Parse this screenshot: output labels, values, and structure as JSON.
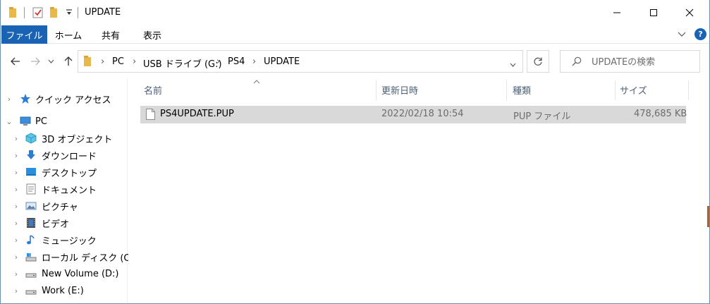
{
  "window": {
    "title": "UPDATE",
    "buttons": {
      "minimize": "—",
      "maximize": "☐",
      "close": "✕"
    }
  },
  "ribbon": {
    "tabs": [
      {
        "label": "ファイル",
        "active": true
      },
      {
        "label": "ホーム"
      },
      {
        "label": "共有"
      },
      {
        "label": "表示"
      }
    ],
    "help": "?"
  },
  "address": {
    "breadcrumbs": [
      "PC",
      "USB ドライブ (G:)",
      "PS4",
      "UPDATE"
    ]
  },
  "search": {
    "placeholder": "UPDATEの検索"
  },
  "nav": {
    "quick_access": "クイック アクセス",
    "pc": "PC",
    "items": [
      {
        "label": "3D オブジェクト",
        "icon": "3d-objects-icon"
      },
      {
        "label": "ダウンロード",
        "icon": "downloads-icon"
      },
      {
        "label": "デスクトップ",
        "icon": "desktop-icon"
      },
      {
        "label": "ドキュメント",
        "icon": "documents-icon"
      },
      {
        "label": "ピクチャ",
        "icon": "pictures-icon"
      },
      {
        "label": "ビデオ",
        "icon": "videos-icon"
      },
      {
        "label": "ミュージック",
        "icon": "music-icon"
      },
      {
        "label": "ローカル ディスク (C:)",
        "icon": "local-disk-icon"
      },
      {
        "label": "New Volume (D:)",
        "icon": "drive-icon"
      },
      {
        "label": "Work (E:)",
        "icon": "drive-icon"
      }
    ]
  },
  "columns": [
    "名前",
    "更新日時",
    "種類",
    "サイズ"
  ],
  "files": [
    {
      "name": "PS4UPDATE.PUP",
      "modified": "2022/02/18 10:54",
      "type": "PUP ファイル",
      "size": "478,685 KB"
    }
  ],
  "colors": {
    "accent": "#1a62b4",
    "selected_row": "#d9d9d9",
    "header_text": "#4c607a"
  }
}
